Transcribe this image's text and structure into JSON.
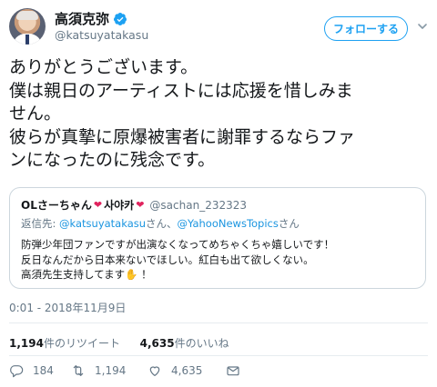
{
  "author": {
    "display_name": "高須克弥",
    "handle": "@katsuyatakasu",
    "verified": true
  },
  "follow_button": {
    "label": "フォローする"
  },
  "tweet": {
    "text": "ありがとうございます。\n僕は親日のアーティストには応援を惜しみま\nせん。\n彼らが真摯に原爆被害者に謝罪するならファ\nンになったのに残念です。",
    "timestamp": "0:01 - 2018年11月9日"
  },
  "quoted_tweet": {
    "name": "OLさーちゃん",
    "name_korean": "사야카",
    "handle": "@sachan_232323",
    "reply_prefix": "返信先: ",
    "reply_mention_1": "@katsuyatakasu",
    "reply_san_1": "さん、",
    "reply_mention_2": "@YahooNewsTopics",
    "reply_san_2": "さん",
    "body": "防弾少年団ファンですが出演なくなってめちゃくちゃ嬉しいです！\n反日なんだから日本来ないでほしい。紅白も出て欲しくない。\n高須先生支持してます",
    "body_emoji": "✋",
    "body_end": " ！"
  },
  "stats": {
    "retweets_count": "1,194",
    "retweets_label": "件のリツイート",
    "likes_count": "4,635",
    "likes_label": "件のいいね"
  },
  "actions": {
    "reply_count": "184",
    "retweet_count": "1,194",
    "like_count": "4,635"
  },
  "colors": {
    "accent": "#1da1f2",
    "heart": "#e0245e",
    "muted": "#657786"
  }
}
